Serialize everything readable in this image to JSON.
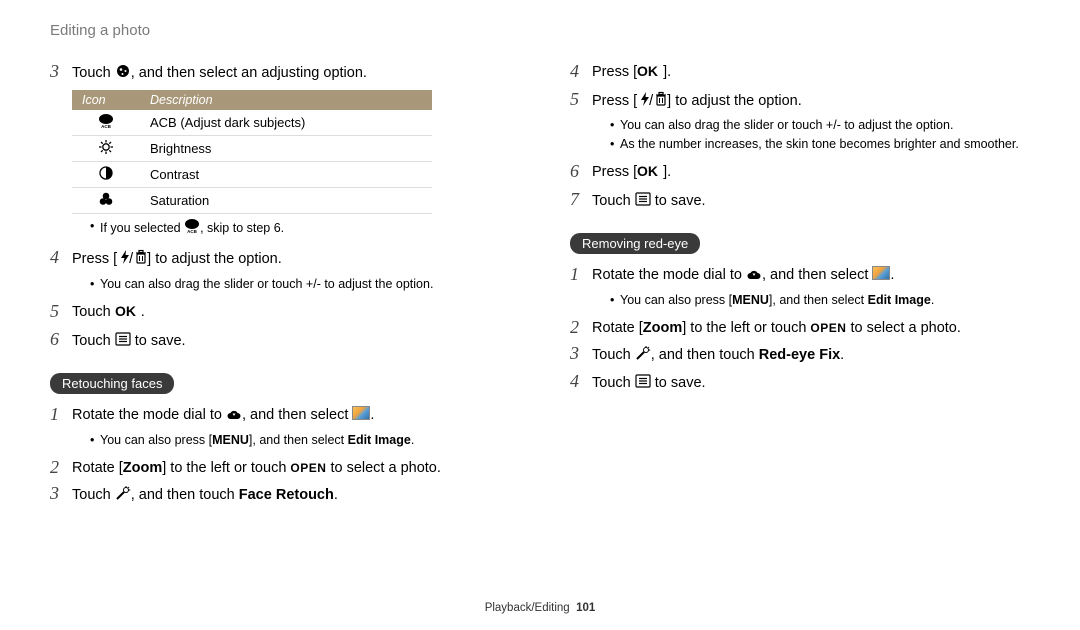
{
  "header": {
    "title": "Editing a photo"
  },
  "footer": {
    "section": "Playback/Editing",
    "page": "101"
  },
  "left": {
    "s3": {
      "pre": "Touch ",
      "post": ", and then select an adjusting option."
    },
    "table": {
      "cols": [
        "Icon",
        "Description"
      ],
      "rows": [
        {
          "desc": "ACB (Adjust dark subjects)"
        },
        {
          "desc": "Brightness"
        },
        {
          "desc": "Contrast"
        },
        {
          "desc": "Saturation"
        }
      ]
    },
    "s3_note": {
      "pre": "If you selected ",
      "post": ", skip to step 6."
    },
    "s4": {
      "pre": "Press [",
      "post": "] to adjust the option."
    },
    "s4_note": "You can also drag the slider or touch +/- to adjust the option.",
    "s5": {
      "pre": "Touch ",
      "post": "."
    },
    "s6": {
      "pre": "Touch ",
      "post": " to save."
    },
    "heading1": "Retouching faces",
    "rf1": {
      "pre": "Rotate the mode dial to ",
      "mid": ", and then select ",
      "post": "."
    },
    "rf1_note": {
      "pre": "You can also press [",
      "mid": "], and then select ",
      "bold": "Edit Image",
      "post": "."
    },
    "rf2": {
      "pre": "Rotate [",
      "zoom": "Zoom",
      "mid": "] to the left or touch ",
      "open": "OPEN",
      "post": " to select a photo."
    },
    "rf3": {
      "pre": "Touch ",
      "mid": ", and then touch ",
      "bold": "Face Retouch",
      "post": "."
    }
  },
  "right": {
    "s4": {
      "pre": "Press [",
      "post": "]."
    },
    "s5": {
      "pre": "Press [",
      "post": "] to adjust the option."
    },
    "s5_note1": "You can also drag the slider or touch +/- to adjust the option.",
    "s5_note2": "As the number increases, the skin tone becomes brighter and smoother.",
    "s6": {
      "pre": "Press [",
      "post": "]."
    },
    "s7": {
      "pre": "Touch ",
      "post": " to save."
    },
    "heading2": "Removing red-eye",
    "re1": {
      "pre": "Rotate the mode dial to ",
      "mid": ", and then select ",
      "post": "."
    },
    "re1_note": {
      "pre": "You can also press [",
      "mid": "], and then select ",
      "bold": "Edit Image",
      "post": "."
    },
    "re2": {
      "pre": "Rotate [",
      "zoom": "Zoom",
      "mid": "] to the left or touch ",
      "open": "OPEN",
      "post": " to select a photo."
    },
    "re3": {
      "pre": "Touch ",
      "mid": ", and then touch ",
      "bold": "Red-eye Fix",
      "post": "."
    },
    "re4": {
      "pre": "Touch ",
      "post": " to save."
    }
  }
}
